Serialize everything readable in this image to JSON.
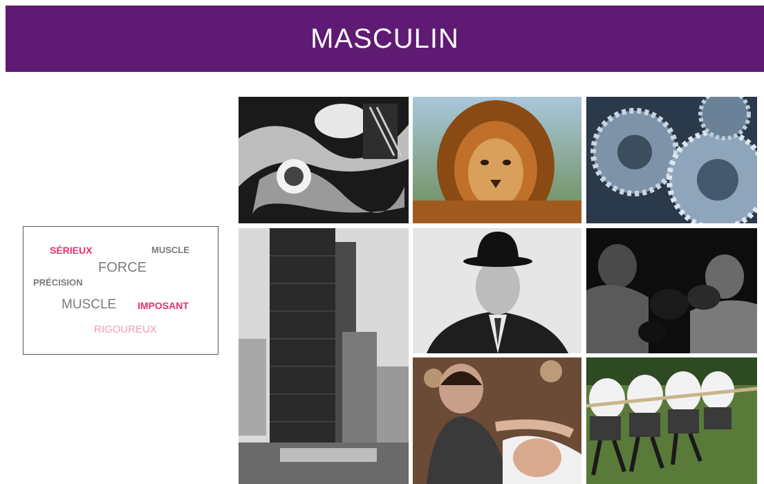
{
  "banner": {
    "title": "MASCULIN"
  },
  "words": [
    "SÉRIEUX",
    "MUSCLE",
    "FORCE",
    "PRÉCISION",
    "MUSCLE",
    "IMPOSANT",
    "RIGOUREUX"
  ],
  "colors": {
    "banner": "#5f1a73",
    "accent_pink": "#e0306e",
    "light_pink": "#f09ac0",
    "gray_text": "#7a7a7a"
  }
}
